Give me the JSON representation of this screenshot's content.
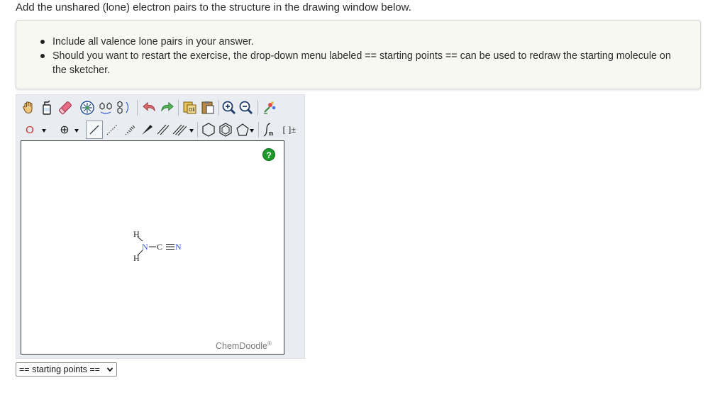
{
  "prompt": "Add the unshared (lone) electron pairs to the structure in the drawing window below.",
  "instructions": [
    "Include all valence lone pairs in your answer.",
    "Should you want to restart the exercise, the drop-down menu labeled == starting points == can be used to redraw the starting molecule on the sketcher."
  ],
  "toolbar_row1": [
    "hand-icon",
    "eraser-bottle-icon",
    "eraser-icon",
    "center-icon",
    "flip-icon",
    "flip-vertical-icon",
    "undo-icon",
    "redo-icon",
    "copy-icon",
    "paste-icon",
    "zoom-in-icon",
    "zoom-out-icon",
    "clean-icon"
  ],
  "toolbar_row2": {
    "element": "O",
    "charge": "⊕",
    "templates_label": "[ ]±"
  },
  "canvas": {
    "help": "?",
    "brand": "ChemDoodle",
    "brand_mark": "®",
    "molecule": {
      "atoms": [
        "H",
        "N",
        "C",
        "N",
        "H"
      ],
      "label_top_h": "H",
      "label_bottom_h": "H",
      "label_n": "N",
      "label_c": "C",
      "label_n2": "N"
    }
  },
  "starting_points": {
    "selected": "== starting points =="
  },
  "colors": {
    "nitrogen": "#3a5bd6",
    "accent_green": "#1d9a2c",
    "panel_bg": "#e9edf1",
    "note_bg": "#f8f8f3"
  }
}
